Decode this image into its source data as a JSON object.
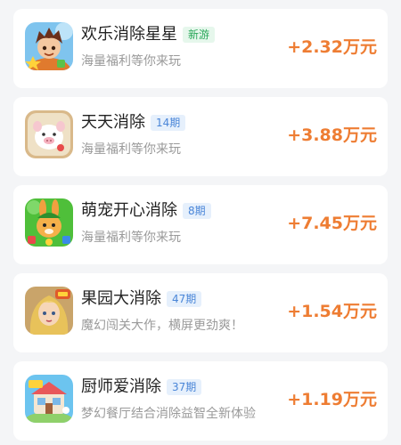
{
  "games": [
    {
      "icon": "cartoon-boy-game-icon",
      "title": "欢乐消除星星",
      "tag": "新游",
      "subtitle": "海量福利等你来玩",
      "reward": "+2.32万元",
      "tag_color": "#2aa85a"
    },
    {
      "icon": "white-pig-game-icon",
      "title": "天天消除",
      "tag": "14期",
      "subtitle": "海量福利等你来玩",
      "reward": "+3.88万元",
      "tag_color": "#4a86d8"
    },
    {
      "icon": "rabbit-pet-game-icon",
      "title": "萌宠开心消除",
      "tag": "8期",
      "subtitle": "海量福利等你来玩",
      "reward": "+7.45万元",
      "tag_color": "#4a86d8"
    },
    {
      "icon": "blonde-girl-game-icon",
      "title": "果园大消除",
      "tag": "47期",
      "subtitle": "魔幻闯关大作，横屏更劲爽！",
      "reward": "+1.54万元",
      "tag_color": "#4a86d8"
    },
    {
      "icon": "restaurant-building-game-icon",
      "title": "厨师爱消除",
      "tag": "37期",
      "subtitle": "梦幻餐厅结合消除益智全新体验",
      "reward": "+1.19万元",
      "tag_color": "#4a86d8"
    }
  ],
  "colors": {
    "background": "#f4f5f7",
    "reward": "#ee7d33",
    "subtitle": "#9a9a9a"
  }
}
